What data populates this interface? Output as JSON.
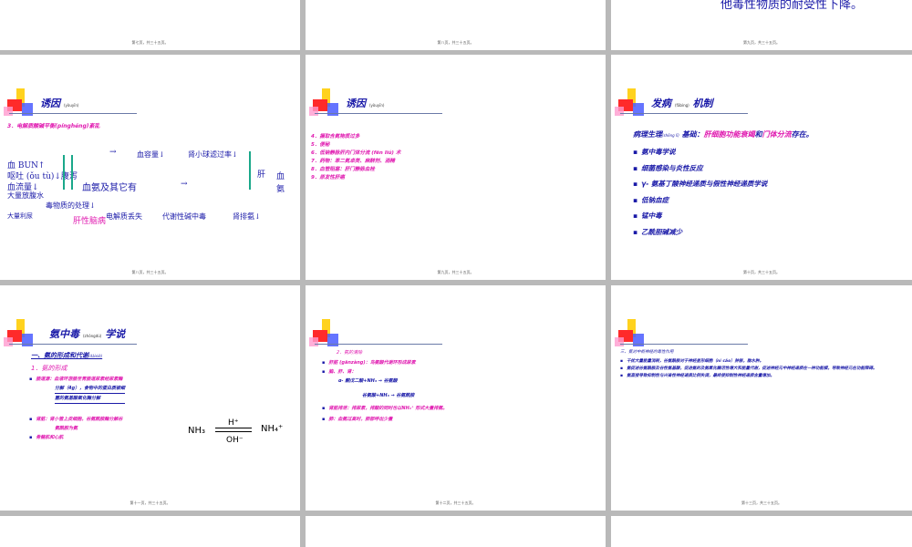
{
  "slides": {
    "s1": {
      "footer": "第七页，共三十五页。"
    },
    "s2": {
      "footer": "第八页，共三十五页。"
    },
    "s3": {
      "text": "他毒性物质的耐受性下降。",
      "footer": "第九页，共三十五页。"
    },
    "s4": {
      "title": "诱因",
      "title_note": "(yòuyīn)",
      "subtitle": "3．电解质酸碱平衡(pínghéng)紊乱",
      "lines": {
        "bun": "血 BUN↑",
        "vomit": "呕吐 (ǒu tù)↓腹泻",
        "flow": "血流量↓",
        "lose": "大量放腹水",
        "volume": "血容量↓",
        "gfr": "肾小球滤过率↓",
        "arrow1": "→",
        "arrow2": "→",
        "nh3": "血氨及其它有",
        "tox": "毒物质的处理↓",
        "liver": "肝",
        "xue": "血",
        "an": "氨",
        "urine": "大量利尿",
        "electro": "电解质丢失",
        "alk": "代谢性碱中毒",
        "renal": "肾排氨↓",
        "he": "肝性脑病"
      },
      "footer": "第八页，共三十五页。"
    },
    "s5": {
      "title": "诱因",
      "title_note": "(yòuyīn)",
      "items": [
        "4．摄取含氮物质过多",
        "5．便秘",
        "6．低钠静脉肝内门体分流 (fēn liú) 术",
        "7．药物：苯二氮卓类、麻醉剂、酒精",
        "8．血管阻塞：肝门静脉血栓",
        "9．原发性肝癌"
      ],
      "footer": "第九页，共三十五页。"
    },
    "s6": {
      "title": "发病",
      "title_note": "(fābìng)",
      "title2": "机制",
      "lead": "病理生理",
      "lead_note": "(shēng lǐ)",
      "lead_rest": " 基础：",
      "lead_hl1": "肝细胞功能衰竭",
      "lead_and": "和",
      "lead_hl2": "门体分流",
      "lead_end": "存在。",
      "bullets": [
        "氨中毒学说",
        "细菌感染与炎性反应",
        "γ- 氨基丁酸神经递质与假性神经递质学说",
        "低钠血症",
        "锰中毒",
        "乙酰胆碱减少"
      ],
      "footer": "第十页，共三十五页。"
    },
    "s7": {
      "title": "氨中毒",
      "title_note": "(zhòngdú)",
      "title2": "学说",
      "sec": "一、氨的形成和代谢",
      "sec_note": "(dàixiè)",
      "sub": "1．氨的形成",
      "b1": "肠道源：血液环游肠至胃肠道尿素经尿素酶",
      "b1a": "分解（4g），食物中的蛋白质被细",
      "b1b": "菌的氨基酸氧化酶分解",
      "b2": "肾脏：肾小管上皮细胞，谷氨酰胺酶分解谷",
      "b2a": "氨酰胺为氨",
      "b3": "骨骼肌和心肌",
      "eq_left": "NH₃",
      "eq_top": "H⁺",
      "eq_bottom": "OH⁻",
      "eq_right": "NH₄⁺",
      "footer": "第十一页，共三十五页。"
    },
    "s8": {
      "sec": "2．氨的清除",
      "b1": "肝脏 (gānzàng)：鸟氨酸代谢环形成尿素",
      "b2": "脑、肝、肾：",
      "l1": "α- 酮戊二酸+NH₃ → 谷氨酸",
      "l2": "谷氨酸+NH₃ → 谷氨酰胺",
      "b3": "肾脏排泄：排尿素，排酸的同时也以NH₄⁺ 形式大量排氨。",
      "b4": "肺：血氨过高时，肺部呼出少量",
      "footer": "第十二页，共三十五页。"
    },
    "s9": {
      "sec": "三、氨对中枢神经的毒性作用",
      "b1": "干扰大量能量消耗，谷氨酰胺对于神经星形细胞（ní cǎo）肿胀，脑水肿。",
      "b2": "氨促进谷氨酰胺及谷性氨基酸，促进氨的及氨氧化酶活性增大和能量代谢，促进神经元中神经递质在一种功能模，导致神经元在功能障碍。",
      "b3": "氨直接导致抑制性与兴奋性神经递质比例失调，最终使抑制性神经递质含量增加。",
      "footer": "第十三页，共三十五页。"
    }
  }
}
